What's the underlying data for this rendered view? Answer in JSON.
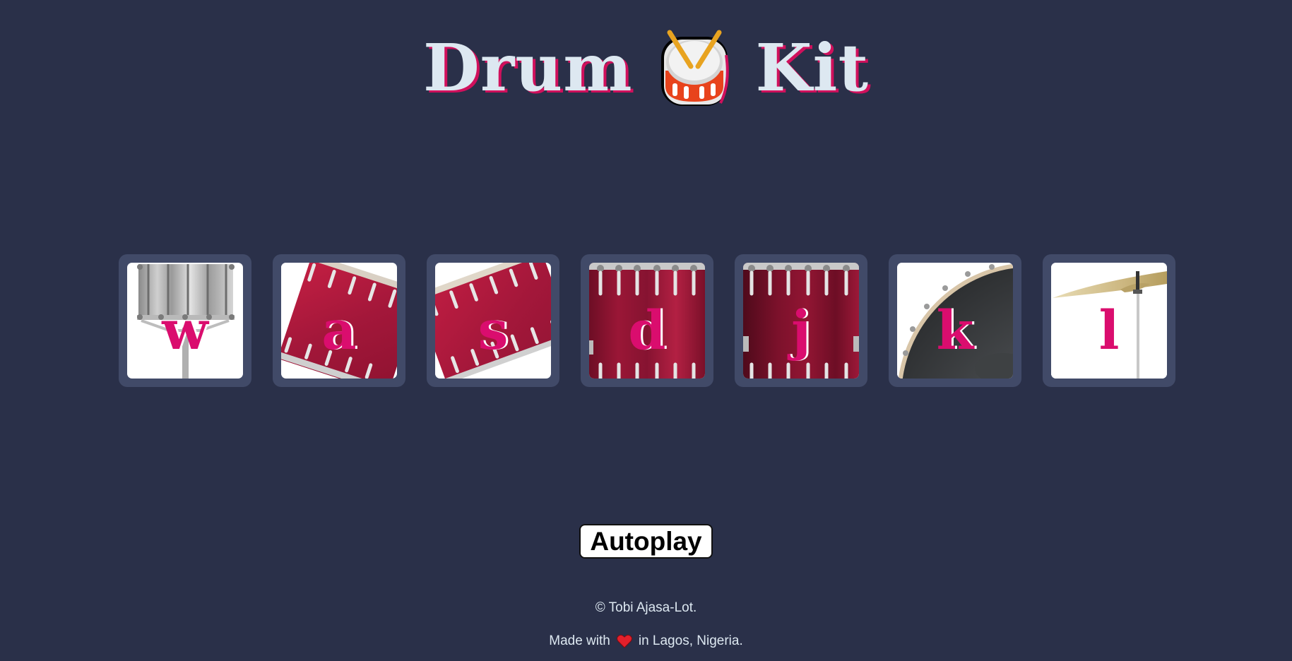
{
  "header": {
    "title_left": "Drum",
    "title_right": "Kit",
    "emoji": "drum-emoji"
  },
  "keys": [
    {
      "letter": "w",
      "instrument": "snare-drum-stand-icon"
    },
    {
      "letter": "a",
      "instrument": "red-tom-drum-icon"
    },
    {
      "letter": "s",
      "instrument": "red-tom-drum-icon"
    },
    {
      "letter": "d",
      "instrument": "red-floor-tom-icon"
    },
    {
      "letter": "j",
      "instrument": "red-floor-tom-icon"
    },
    {
      "letter": "k",
      "instrument": "bass-drum-icon"
    },
    {
      "letter": "l",
      "instrument": "cymbal-icon"
    }
  ],
  "controls": {
    "autoplay_label": "Autoplay"
  },
  "footer": {
    "copyright": "© Tobi Ajasa-Lot.",
    "made_with": "Made with",
    "location": "in Lagos, Nigeria."
  },
  "colors": {
    "background": "#2a3049",
    "key_frame": "#414a68",
    "accent": "#da0d6e",
    "title_text": "#dde8f1",
    "drum_red": "#a3173a"
  }
}
